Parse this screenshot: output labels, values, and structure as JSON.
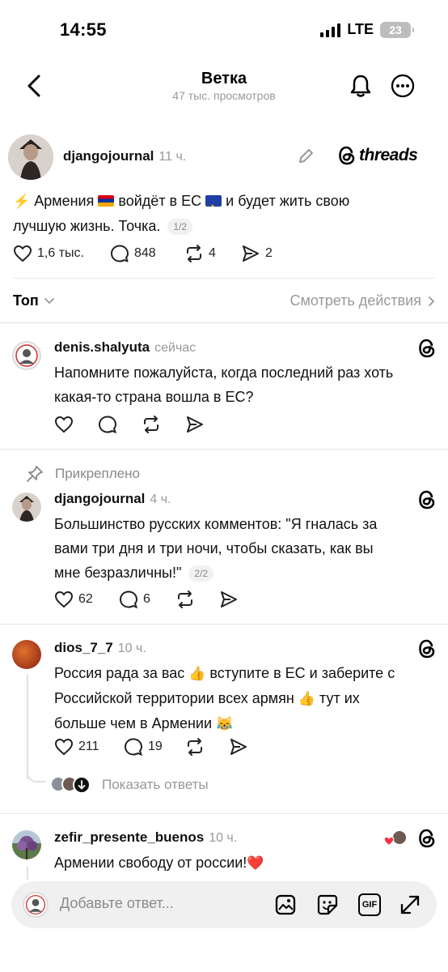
{
  "status": {
    "time": "14:55",
    "network": "LTE",
    "battery": "23"
  },
  "header": {
    "title": "Ветка",
    "subtitle": "47 тыс. просмотров"
  },
  "op": {
    "username": "djangojournal",
    "time": "11 ч.",
    "brand": "threads",
    "text_1": "Армения",
    "text_2": "войдёт в ЕС",
    "text_3": "и будет жить свою",
    "text_4": "лучшую жизнь. Точка.",
    "pager": "1/2",
    "likes": "1,6 тыс.",
    "comments": "848",
    "reposts": "4",
    "shares": "2"
  },
  "sort": {
    "label": "Топ",
    "activity_link": "Смотреть действия"
  },
  "replies": [
    {
      "username": "denis.shalyuta",
      "time": "сейчас",
      "line1": "Напомните пожалуйста, когда последний раз хоть",
      "line2": "какая-то страна вошла в ЕС?"
    },
    {
      "pinned_label": "Прикреплено",
      "username": "djangojournal",
      "time": "4 ч.",
      "line1": "Большинство русских комментов: \"Я гналась за",
      "line2": "вами три дня и три ночи, чтобы сказать, как вы",
      "line3": "мне безразличны!\"",
      "pager": "2/2",
      "likes": "62",
      "comments": "6"
    },
    {
      "username": "dios_7_7",
      "time": "10 ч.",
      "line1": "Россия рада за вас",
      "line1b": "вступите в ЕС и заберите с",
      "line2": "Российской территории всех армян",
      "line2b": "тут их",
      "line3": "больше чем в Армении",
      "likes": "211",
      "comments": "19",
      "show_replies": "Показать ответы"
    },
    {
      "username": "zefir_presente_buenos",
      "time": "10 ч.",
      "line1": "Армении свободу от россии!"
    }
  ],
  "composer": {
    "placeholder": "Добавьте ответ...",
    "gif_label": "GIF"
  },
  "colors": {
    "muted": "#999999",
    "divider": "#e6e6e6",
    "composer_bg": "#f0f0f0"
  }
}
